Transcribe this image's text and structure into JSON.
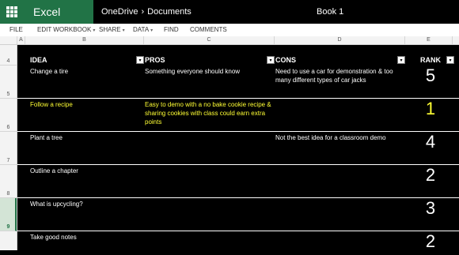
{
  "app": {
    "brand": "Excel Online",
    "breadcrumb_root": "OneDrive",
    "breadcrumb_sep": "›",
    "breadcrumb_folder": "Documents",
    "doc_title": "Book 1"
  },
  "ribbon": {
    "file": "FILE",
    "edit": "EDIT WORKBOOK",
    "share": "SHARE",
    "data": "DATA",
    "find": "FIND",
    "comments": "COMMENTS",
    "caret": "▾"
  },
  "columns": [
    "A",
    "B",
    "C",
    "D",
    "E"
  ],
  "row_numbers": [
    "4",
    "5",
    "6",
    "7",
    "8",
    "9"
  ],
  "selected_row": "9",
  "headers": {
    "idea": "IDEA",
    "pros": "PROS",
    "cons": "CONS",
    "rank": "RANK",
    "filter_icon": "▾"
  },
  "rows": [
    {
      "idea": "Change a tire",
      "pros": "Something everyone should know",
      "cons": "Need to use a car for demonstration & too many different types of car jacks",
      "rank": "5",
      "highlight": false
    },
    {
      "idea": "Follow a recipe",
      "pros": "Easy to demo with a no bake cookie recipe & sharing cookies with class could earn extra points",
      "cons": "",
      "rank": "1",
      "highlight": true
    },
    {
      "idea": "Plant a tree",
      "pros": "",
      "cons": "Not the best idea for a classroom demo",
      "rank": "4",
      "highlight": false
    },
    {
      "idea": "Outline a chapter",
      "pros": "",
      "cons": "",
      "rank": "2",
      "highlight": false
    },
    {
      "idea": "What is upcycling?",
      "pros": "",
      "cons": "",
      "rank": "3",
      "highlight": false
    },
    {
      "idea": "Take good notes",
      "pros": "",
      "cons": "",
      "rank": "2",
      "highlight": false
    }
  ],
  "colors": {
    "excel_green": "#217346",
    "highlight_text": "#ffff33",
    "sheet_bg": "#000000",
    "text": "#ffffff"
  }
}
